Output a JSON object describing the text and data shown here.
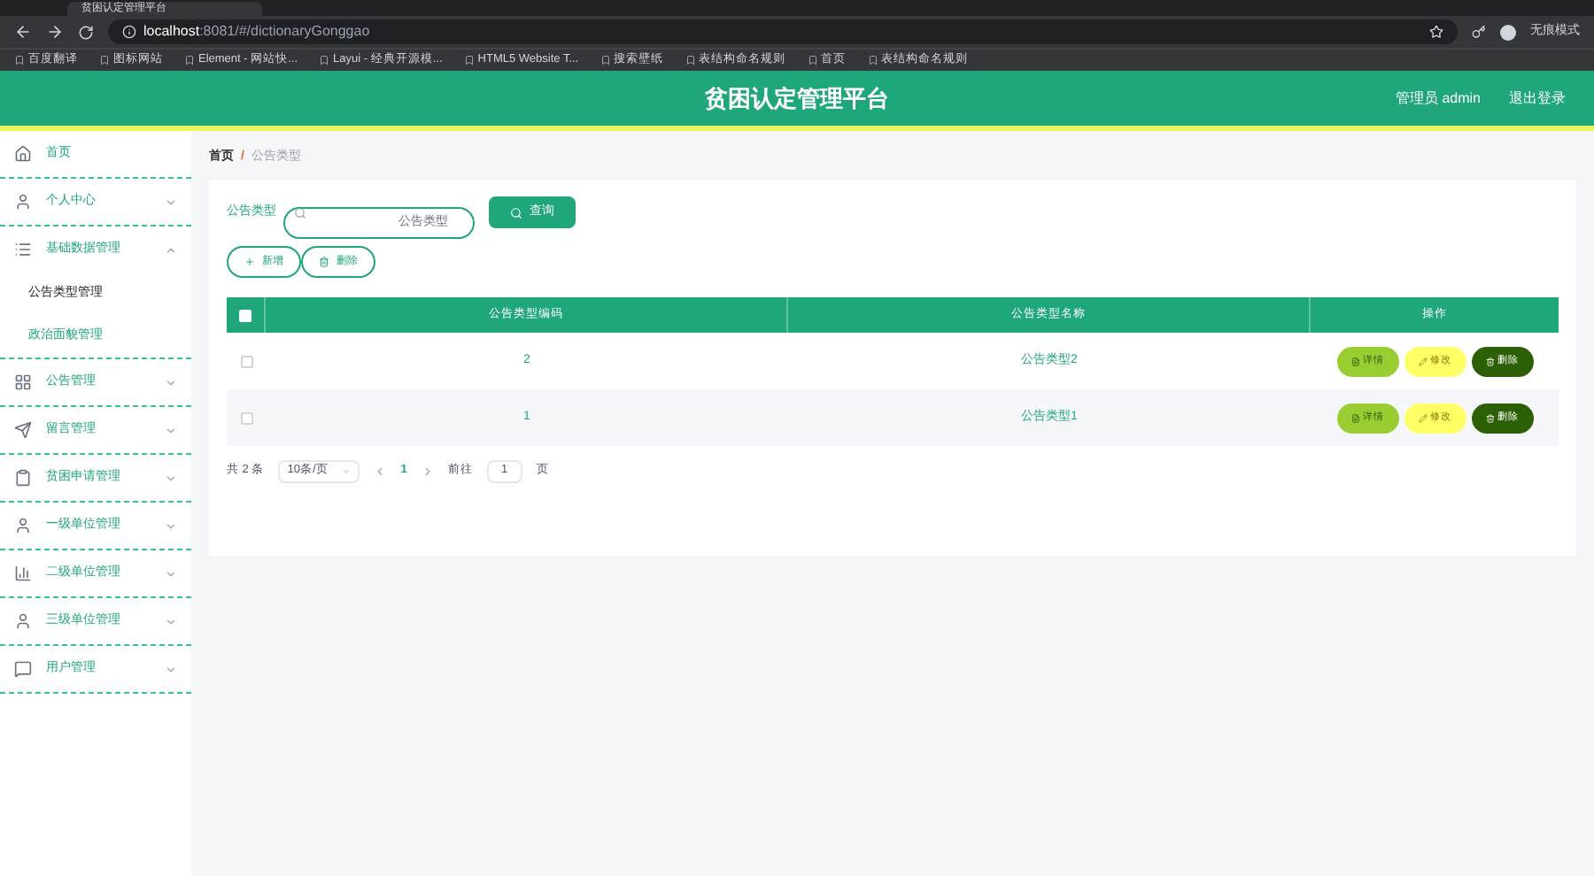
{
  "browser": {
    "tab_title": "贫困认定管理平台",
    "url_host": "localhost",
    "url_rest": ":8081/#/dictionaryGonggao",
    "profile": "无痕模式",
    "bookmarks": [
      "百度翻译",
      "图标网站",
      "Element - 网站快...",
      "Layui - 经典开源模...",
      "HTML5 Website T...",
      "搜索壁纸",
      "表结构命名规则",
      "首页",
      "表结构命名规则"
    ]
  },
  "header": {
    "title": "贫困认定管理平台",
    "user": "管理员 admin",
    "logout": "退出登录"
  },
  "sidebar": {
    "items": [
      {
        "label": "首页"
      },
      {
        "label": "个人中心"
      },
      {
        "label": "基础数据管理",
        "expanded": true,
        "children": [
          {
            "label": "公告类型管理",
            "selected": true
          },
          {
            "label": "政治面貌管理",
            "selected": false
          }
        ]
      },
      {
        "label": "公告管理"
      },
      {
        "label": "留言管理"
      },
      {
        "label": "贫困申请管理"
      },
      {
        "label": "一级单位管理"
      },
      {
        "label": "二级单位管理"
      },
      {
        "label": "三级单位管理"
      },
      {
        "label": "用户管理"
      }
    ]
  },
  "breadcrumb": [
    "首页",
    "公告类型"
  ],
  "breadcrumb_separator": "/",
  "search": {
    "label": "公告类型",
    "placeholder": "公告类型",
    "button": "查询"
  },
  "actions": [
    "新增",
    "删除"
  ],
  "table": {
    "all_checked": false,
    "columns": [
      "公告类型编码",
      "公告类型名称",
      "操作"
    ],
    "rows": [
      {
        "code": "2",
        "name": "公告类型2",
        "checked": false,
        "buttons": [
          "详情",
          "修改",
          "删除"
        ]
      },
      {
        "code": "1",
        "name": "公告类型1",
        "checked": false,
        "buttons": [
          "详情",
          "修改",
          "删除"
        ]
      }
    ]
  },
  "pagination": {
    "total": "共 2 条",
    "page_size": "10条/页",
    "pages": [
      {
        "label": "1",
        "selected": true
      }
    ],
    "goto": "前往",
    "goto_value": "1",
    "page_unit": "页"
  }
}
